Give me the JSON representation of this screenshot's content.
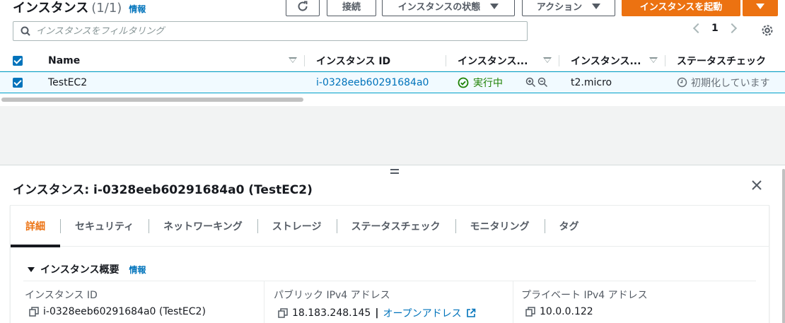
{
  "header": {
    "title": "インスタンス",
    "count": "(1/1)",
    "info": "情報"
  },
  "toolbar": {
    "refresh_icon": "refresh-icon",
    "connect": "接続",
    "instance_state": "インスタンスの状態",
    "actions": "アクション",
    "launch": "インスタンスを起動"
  },
  "search": {
    "placeholder": "インスタンスをフィルタリング"
  },
  "pagination": {
    "page": "1"
  },
  "table": {
    "columns": [
      "Name",
      "インスタンス ID",
      "インスタンス...",
      "インスタンス...",
      "ステータスチェック"
    ],
    "rows": [
      {
        "name": "TestEC2",
        "instance_id": "i-0328eeb60291684a0",
        "state": "実行中",
        "type": "t2.micro",
        "status_check": "初期化しています"
      }
    ]
  },
  "detail": {
    "title": "インスタンス: i-0328eeb60291684a0 (TestEC2)",
    "tabs": [
      "詳細",
      "セキュリティ",
      "ネットワーキング",
      "ストレージ",
      "ステータスチェック",
      "モニタリング",
      "タグ"
    ],
    "section_title": "インスタンス概要",
    "section_info": "情報",
    "fields": [
      {
        "label": "インスタンス ID",
        "value": "i-0328eeb60291684a0 (TestEC2)"
      },
      {
        "label": "パブリック IPv4 アドレス",
        "value": "18.183.248.145",
        "separator": "|",
        "link": "オープンアドレス"
      },
      {
        "label": "プライベート IPv4 アドレス",
        "value": "10.0.0.122"
      }
    ]
  },
  "colors": {
    "accent": "#ec7211",
    "link": "#0073bb",
    "success": "#1d8102"
  }
}
